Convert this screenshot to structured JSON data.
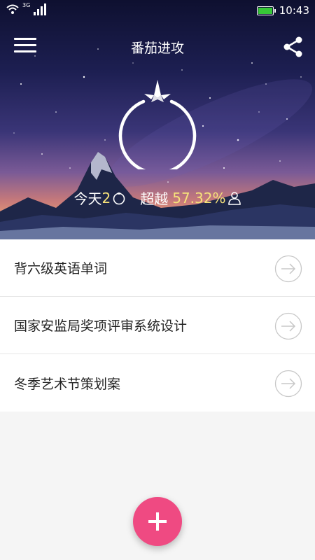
{
  "status_bar": {
    "network": "3G",
    "time": "10:43",
    "icons": [
      "wifi-icon",
      "signal-icon",
      "battery-icon"
    ]
  },
  "app_bar": {
    "title": "番茄进攻",
    "menu_icon": "menu-icon",
    "share_icon": "share-icon"
  },
  "stats": {
    "today_label": "今天",
    "today_count": "2",
    "surpass_label": "超越",
    "surpass_percent": "57.32%"
  },
  "tasks": [
    {
      "label": "背六级英语单词"
    },
    {
      "label": "国家安监局奖项评审系统设计"
    },
    {
      "label": "冬季艺术节策划案"
    }
  ],
  "colors": {
    "accent": "#ef4a82",
    "stat_highlight": "#f6e27a"
  }
}
